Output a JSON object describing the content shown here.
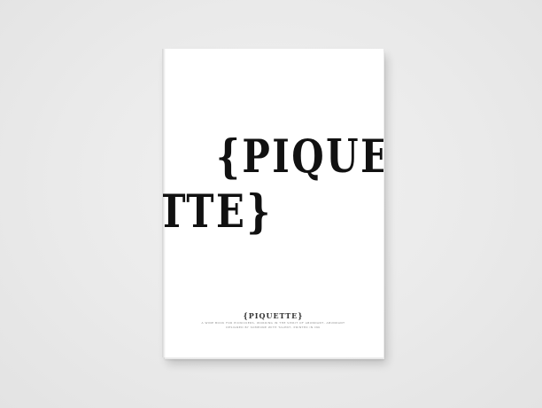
{
  "cover": {
    "big_line_1": "{PIQUETTE",
    "big_line_2": "ETTE}",
    "small_title": "{PIQUETTE}",
    "caption_line_1": "A WINE BOOK FOR PICNICKERS, WORKING IN THE SPIRIT OF ABUNDANT, ABUNDANT",
    "caption_line_2": "DESIGNED BY SOMEONE WITH TALENT, PRINTED IN INK"
  },
  "colors": {
    "background": "#ebebeb",
    "cover": "#ffffff",
    "ink": "#111111"
  }
}
